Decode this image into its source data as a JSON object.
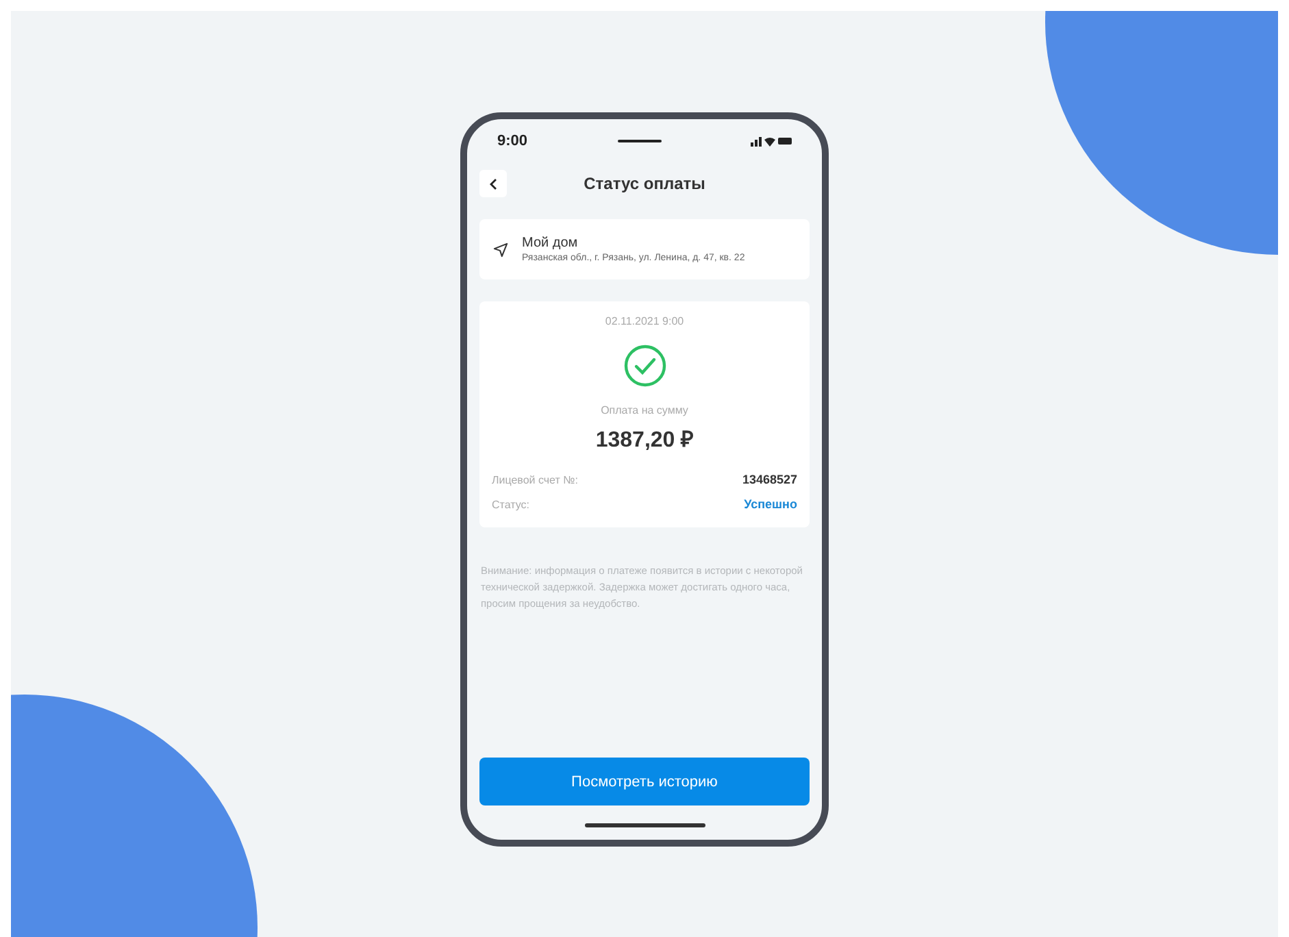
{
  "status_bar": {
    "time": "9:00"
  },
  "header": {
    "title": "Статус оплаты"
  },
  "address": {
    "name": "Мой дом",
    "line": "Рязанская обл., г. Рязань, ул. Ленина, д. 47, кв. 22"
  },
  "payment": {
    "datetime": "02.11.2021 9:00",
    "amount_label": "Оплата на сумму",
    "amount": "1387,20 ₽",
    "details": [
      {
        "label": "Лицевой счет №:",
        "value": "13468527",
        "kind": "plain"
      },
      {
        "label": "Статус:",
        "value": "Успешно",
        "kind": "status"
      }
    ]
  },
  "notice": "Внимание: информация о платеже появится в истории с некоторой технической задержкой. Задержка может достигать одного часа, просим прощения за неудобство.",
  "button": "Посмотреть историю"
}
